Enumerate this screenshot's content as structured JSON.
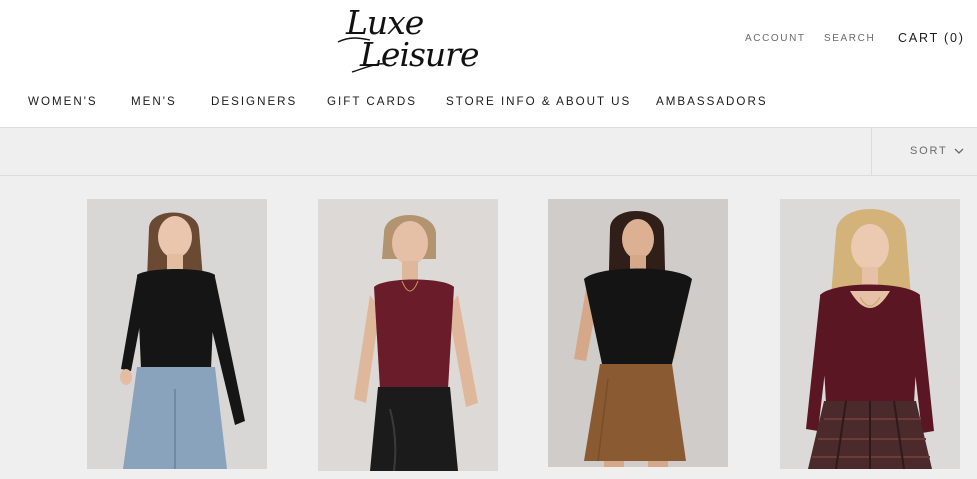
{
  "brand": {
    "name": "Luxe Leisure",
    "line1": "Luxe",
    "line2": "Leisure"
  },
  "header_links": {
    "account": "ACCOUNT",
    "search": "SEARCH",
    "cart": "CART (0)"
  },
  "nav": [
    {
      "label": "WOMEN'S"
    },
    {
      "label": "MEN'S"
    },
    {
      "label": "DESIGNERS"
    },
    {
      "label": "GIFT CARDS"
    },
    {
      "label": "STORE INFO & ABOUT US"
    },
    {
      "label": "AMBASSADORS"
    }
  ],
  "toolbar": {
    "sort_label": "SORT"
  },
  "products": [
    {
      "image": "model-black-long-sleeve-bodysuit-jeans",
      "top_color": "#151515",
      "bottom_color": "#8aa3bd",
      "bg_color": "#d9d7d5"
    },
    {
      "image": "model-burgundy-sleeveless-top-leather-pants",
      "top_color": "#6b1c2a",
      "bottom_color": "#1b1b1b",
      "bg_color": "#ddd9d6"
    },
    {
      "image": "model-black-cap-sleeve-top-suede-skirt",
      "top_color": "#141414",
      "bottom_color": "#8a5a32",
      "bg_color": "#cfccca"
    },
    {
      "image": "model-burgundy-scoop-neck-top-plaid-skirt",
      "top_color": "#5a1622",
      "bottom_color": "#4a2a2a",
      "bg_color": "#dcdad8"
    }
  ],
  "colors": {
    "background": "#ffffff",
    "toolbar_bg": "#efefef",
    "text": "#1c1b1b",
    "muted": "#6a6a6a",
    "border": "#dcdcdc"
  }
}
